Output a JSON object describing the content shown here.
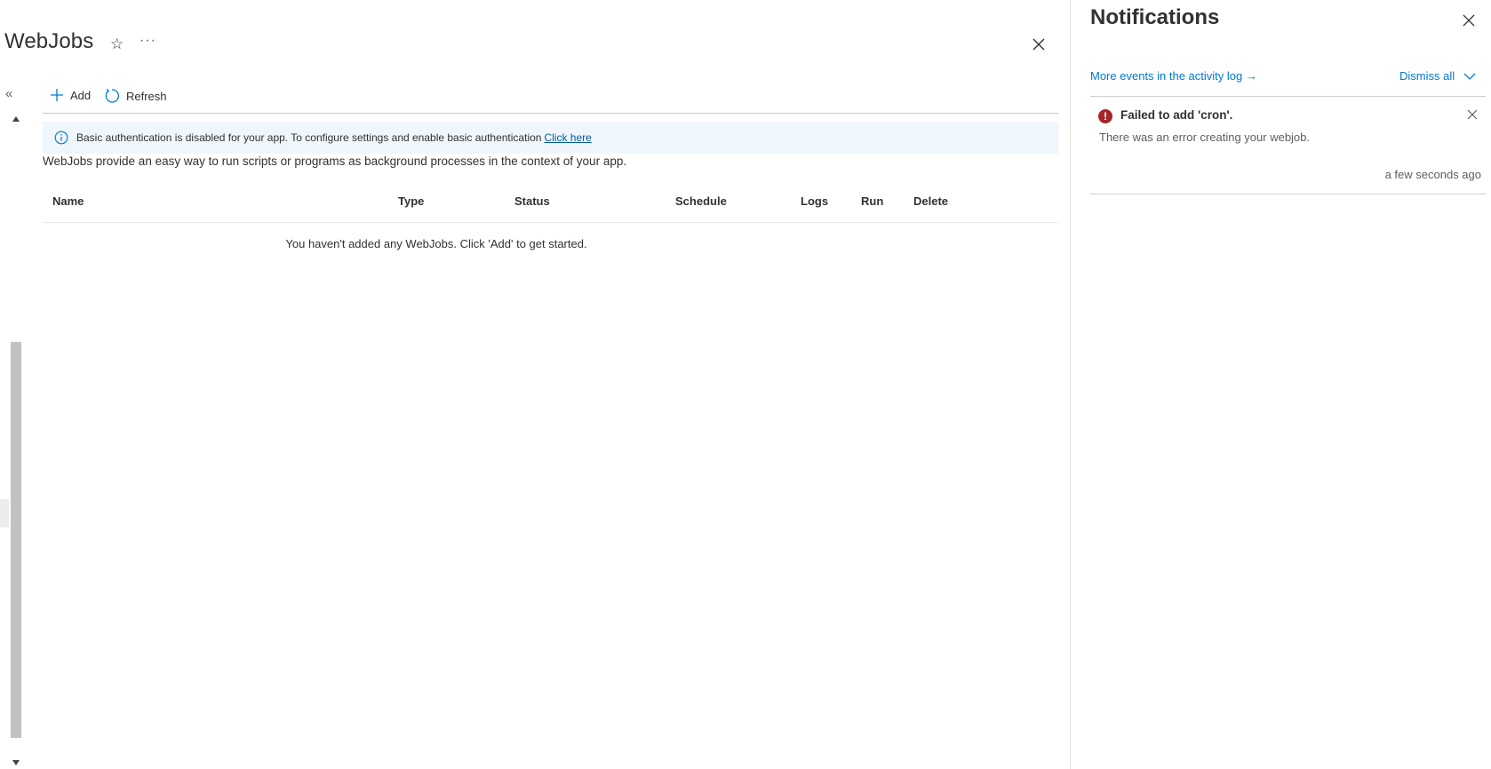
{
  "blade": {
    "title": "WebJobs",
    "star_glyph": "☆",
    "more_glyph": "···",
    "collapse_glyph": "«",
    "toolbar": {
      "add_label": "Add",
      "refresh_label": "Refresh"
    },
    "info_bar": {
      "text": "Basic authentication is disabled for your app. To configure settings and enable basic authentication",
      "link_text": "Click here"
    },
    "description": "WebJobs provide an easy way to run scripts or programs as background processes in the context of your app.",
    "table": {
      "columns": [
        "Name",
        "Type",
        "Status",
        "Schedule",
        "Logs",
        "Run",
        "Delete"
      ],
      "empty_message": "You haven't added any WebJobs. Click 'Add' to get started."
    }
  },
  "notifications": {
    "title": "Notifications",
    "more_events_label": "More events in the activity log →",
    "dismiss_all_label": "Dismiss all",
    "items": [
      {
        "status": "error",
        "status_color": "#a4262c",
        "icon_glyph": "!",
        "heading": "Failed to add 'cron'.",
        "body": "There was an error creating your webjob.",
        "time": "a few seconds ago"
      }
    ]
  },
  "colors": {
    "accent": "#0078d4",
    "info_bar_bg": "#eff6fc",
    "error": "#a4262c"
  }
}
